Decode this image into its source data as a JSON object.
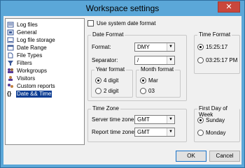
{
  "window": {
    "title": "Workspace settings",
    "close_glyph": "✕"
  },
  "tree": {
    "items": [
      {
        "label": "Log files",
        "icon": "log-files-icon",
        "color": "#3d5a98"
      },
      {
        "label": "General",
        "icon": "general-icon",
        "color": "#3d5a98"
      },
      {
        "label": "Log file storage",
        "icon": "log-storage-icon",
        "color": "#3d5a98"
      },
      {
        "label": "Date Range",
        "icon": "date-range-icon",
        "color": "#3d5a98"
      },
      {
        "label": "File Types",
        "icon": "file-types-icon",
        "color": "#3d5a98"
      },
      {
        "label": "Filters",
        "icon": "filters-icon",
        "color": "#3d5a98"
      },
      {
        "label": "Workgroups",
        "icon": "workgroups-icon",
        "color": "#5a3d98"
      },
      {
        "label": "Visitors",
        "icon": "visitors-icon",
        "color": "#5a3d98"
      },
      {
        "label": "Custom reports",
        "icon": "custom-reports-icon",
        "color": "#5a3d98"
      },
      {
        "label": "Date && Time",
        "icon": "date-time-icon",
        "selected": true
      }
    ]
  },
  "system_date_format": {
    "label": "Use system date format",
    "checked": false
  },
  "date_format": {
    "title": "Date Format",
    "format_label": "Format:",
    "format_value": "DMY",
    "separator_label": "Separator:",
    "separator_value": "/",
    "year_format": {
      "title": "Year format",
      "opt1": "4 digit",
      "opt2": "2 digit",
      "selected": "4 digit"
    },
    "month_format": {
      "title": "Month format",
      "opt1": "Mar",
      "opt2": "03",
      "selected": "Mar"
    }
  },
  "time_format": {
    "title": "Time Format",
    "opt1": "15:25:17",
    "opt2": "03:25:17 PM",
    "selected": "15:25:17"
  },
  "time_zone": {
    "title": "Time Zone",
    "server_label": "Server time zone:",
    "server_value": "GMT",
    "report_label": "Report time zone:",
    "report_value": "GMT"
  },
  "first_day": {
    "title": "First Day of Week",
    "opt1": "Sunday",
    "opt2": "Monday",
    "selected": "Sunday"
  },
  "buttons": {
    "ok": "OK",
    "cancel": "Cancel"
  }
}
